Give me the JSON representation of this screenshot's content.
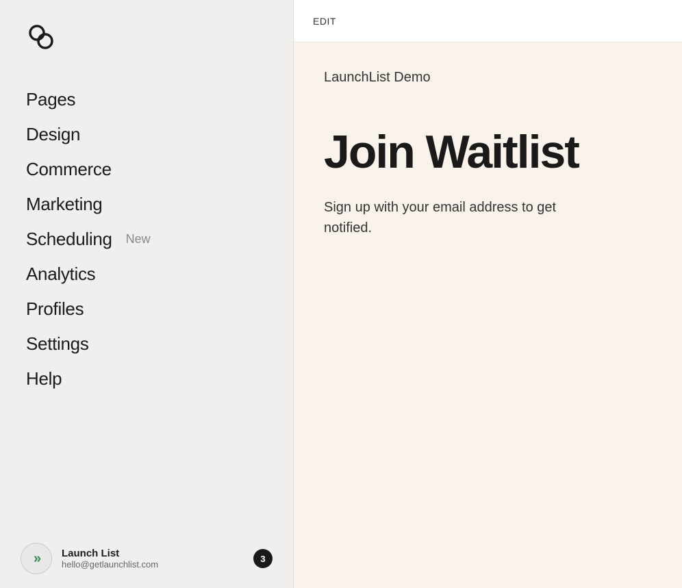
{
  "sidebar": {
    "logo_alt": "Squarespace Logo",
    "nav_items": [
      {
        "id": "pages",
        "label": "Pages",
        "badge": null
      },
      {
        "id": "design",
        "label": "Design",
        "badge": null
      },
      {
        "id": "commerce",
        "label": "Commerce",
        "badge": null
      },
      {
        "id": "marketing",
        "label": "Marketing",
        "badge": null
      },
      {
        "id": "scheduling",
        "label": "Scheduling",
        "badge": "New"
      },
      {
        "id": "analytics",
        "label": "Analytics",
        "badge": null
      },
      {
        "id": "profiles",
        "label": "Profiles",
        "badge": null
      },
      {
        "id": "settings",
        "label": "Settings",
        "badge": null
      },
      {
        "id": "help",
        "label": "Help",
        "badge": null
      }
    ],
    "footer": {
      "avatar_text": "»",
      "name": "Launch List",
      "email": "hello@getlaunchlist.com",
      "notification_count": "3"
    }
  },
  "toolbar": {
    "edit_label": "EDIT"
  },
  "preview": {
    "site_name": "LaunchList Demo",
    "headline": "Join Waitlist",
    "subtext": "Sign up with your email address to get notified.",
    "bg_color": "#faf3ec"
  }
}
